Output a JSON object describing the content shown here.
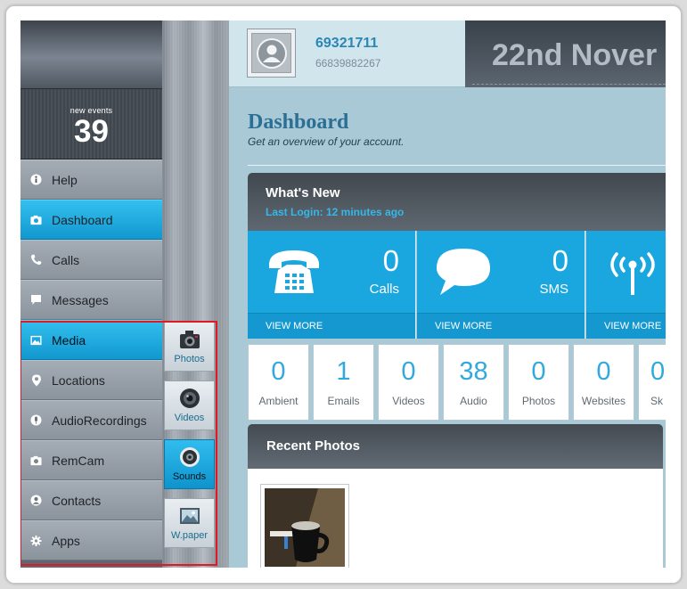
{
  "sidebar": {
    "events_label": "new events",
    "events_count": "39",
    "items": [
      {
        "label": "Help",
        "icon": "info-icon"
      },
      {
        "label": "Dashboard",
        "icon": "camera-icon"
      },
      {
        "label": "Calls",
        "icon": "phone-icon"
      },
      {
        "label": "Messages",
        "icon": "message-icon"
      },
      {
        "label": "Media",
        "icon": "image-icon"
      },
      {
        "label": "Locations",
        "icon": "pin-icon"
      },
      {
        "label": "AudioRecordings",
        "icon": "mic-icon"
      },
      {
        "label": "RemCam",
        "icon": "camera-icon"
      },
      {
        "label": "Contacts",
        "icon": "contact-icon"
      },
      {
        "label": "Apps",
        "icon": "gear-icon"
      }
    ],
    "active": "Media",
    "subitems": [
      {
        "label": "Photos",
        "icon": "camera-icon"
      },
      {
        "label": "Videos",
        "icon": "lens-icon"
      },
      {
        "label": "Sounds",
        "icon": "speaker-icon"
      },
      {
        "label": "W.paper",
        "icon": "wallpaper-icon"
      }
    ]
  },
  "header": {
    "user_id": "69321711",
    "user_phone": "66839882267",
    "date": "22nd Nover"
  },
  "page": {
    "title": "Dashboard",
    "subtitle": "Get an overview of your account."
  },
  "whats_new": {
    "title": "What's New",
    "last_login": "Last Login: 12 minutes ago",
    "stats": [
      {
        "count": "0",
        "label": "Calls",
        "view_more": "VIEW MORE",
        "icon": "telephone-icon"
      },
      {
        "count": "0",
        "label": "SMS",
        "view_more": "VIEW MORE",
        "icon": "speech-bubble-icon"
      },
      {
        "count": "",
        "label": "",
        "view_more": "VIEW MORE",
        "icon": "antenna-icon"
      }
    ]
  },
  "tiles": [
    {
      "count": "0",
      "label": "Ambient"
    },
    {
      "count": "1",
      "label": "Emails"
    },
    {
      "count": "0",
      "label": "Videos"
    },
    {
      "count": "38",
      "label": "Audio"
    },
    {
      "count": "0",
      "label": "Photos"
    },
    {
      "count": "0",
      "label": "Websites"
    },
    {
      "count": "0",
      "label": "Sk"
    }
  ],
  "recent_photos": {
    "title": "Recent Photos"
  },
  "colors": {
    "accent": "#1aa6df",
    "highlight": "#e01a24"
  }
}
